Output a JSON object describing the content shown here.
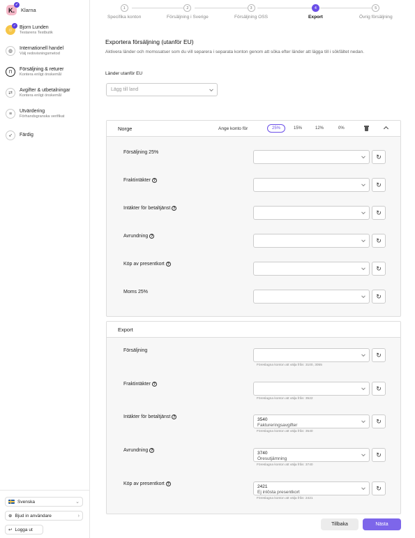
{
  "brand": {
    "name": "Klarna",
    "logo_letter": "K."
  },
  "sidebar": {
    "items": [
      {
        "title": "Bjorn Lunden",
        "sub": "Testarens Testbutik",
        "icon": "user-icon"
      },
      {
        "title": "Internationell handel",
        "sub": "Välj redovisningsmetod",
        "icon": "globe-icon"
      },
      {
        "title": "Försäljning & returer",
        "sub": "Kontera enligt önskemål",
        "icon": "shopping-bag-icon"
      },
      {
        "title": "Avgifter & utbetalningar",
        "sub": "Kontera enligt önskemål",
        "icon": "transfer-icon"
      },
      {
        "title": "Utvärdering",
        "sub": "Förhandsgranska verifikat",
        "icon": "document-icon"
      },
      {
        "title": "Färdig",
        "sub": "",
        "icon": "rocket-icon"
      }
    ],
    "language": "Svenska",
    "invite": "Bjud in användare",
    "logout": "Logga ut"
  },
  "stepper": {
    "steps": [
      {
        "num": "1",
        "label": "Specifika konton"
      },
      {
        "num": "2",
        "label": "Försäljning i Sverige"
      },
      {
        "num": "3",
        "label": "Försäljning OSS"
      },
      {
        "num": "4",
        "label": "Export"
      },
      {
        "num": "5",
        "label": "Övrig försäljning"
      }
    ],
    "active_index": 3
  },
  "main": {
    "title": "Exportera försäljning (utanför EU)",
    "description": "Aktivera länder och momssatser som du vill separera i separata konton genom att söka efter länder att lägga till i sökfältet nedan.",
    "countries_label": "Länder utanför EU",
    "countries_placeholder": "Lägg till land"
  },
  "norway": {
    "title": "Norge",
    "rate_label": "Ange konto för",
    "rates": [
      "25%",
      "15%",
      "12%",
      "0%"
    ],
    "active_rate": "25%",
    "rows": [
      {
        "label": "Försäljning 25%",
        "help": false
      },
      {
        "label": "Fraktintäkter",
        "help": true
      },
      {
        "label": "Intäkter för betaltjänst",
        "help": true
      },
      {
        "label": "Avrundning",
        "help": true
      },
      {
        "label": "Köp av presentkort",
        "help": true
      },
      {
        "label": "Moms 25%",
        "help": false
      }
    ]
  },
  "export": {
    "title": "Export",
    "rows": [
      {
        "label": "Försäljning",
        "help": false,
        "account": "",
        "account_name": "",
        "hint": "Föreslagna konton att välja från: 3100, 3055"
      },
      {
        "label": "Fraktintäkter",
        "help": true,
        "account": "",
        "account_name": "",
        "hint": "Föreslagna konton att välja från: 3522"
      },
      {
        "label": "Intäkter för betaltjänst",
        "help": true,
        "account": "3540",
        "account_name": "Faktureringsavgifter",
        "hint": "Föreslagna konton att välja från: 3540"
      },
      {
        "label": "Avrundning",
        "help": true,
        "account": "3740",
        "account_name": "Öresutjämning",
        "hint": "Föreslagna konton att välja från: 3740"
      },
      {
        "label": "Köp av presentkort",
        "help": true,
        "account": "2421",
        "account_name": "Ej inlösta presentkort",
        "hint": "Föreslagna konton att välja från: 2421"
      }
    ]
  },
  "footer": {
    "back": "Tillbaka",
    "next": "Nästa"
  },
  "colors": {
    "accent": "#6b4fe8",
    "primary_button": "#7d66ea",
    "brand_pink": "#f5b8c8"
  }
}
